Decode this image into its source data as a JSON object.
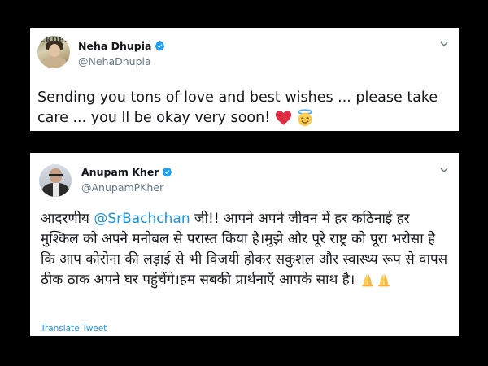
{
  "tweets": [
    {
      "name": "Neha Dhupia",
      "handle": "@NehaDhupia",
      "avatar_text": "ERDES",
      "text": "Sending you tons of love and best wishes ... please take care ... you ll be okay very soon! ",
      "emojis": [
        "red-heart",
        "smiling-face-with-halo"
      ]
    },
    {
      "name": "Anupam Kher",
      "handle": "@AnupamPKher",
      "text_before": "आदरणीय ",
      "mention": "@SrBachchan",
      "text_after": " जी!! आपने अपने जीवन में हर कठिनाई हर मुश्किल को अपने मनोबल से परास्त किया है।मुझे और पूरे राष्ट्र को पूरा भरोसा है कि आप कोरोना की लड़ाई से भी विजयी होकर सकुशल और स्वास्थ्य रूप से वापस ठीक ठाक अपने घर पहुंचेंगे।हम सबकी प्रार्थनाएँ आपके साथ है। ",
      "emojis": [
        "folded-hands",
        "folded-hands"
      ],
      "translate_label": "Translate Tweet"
    }
  ],
  "colors": {
    "link": "#1b95e0",
    "verified": "#1da1f2",
    "muted": "#657786",
    "text": "#14171a"
  }
}
